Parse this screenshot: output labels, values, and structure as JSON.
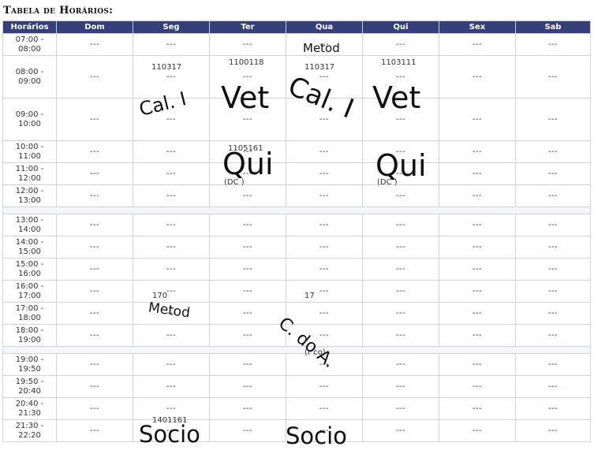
{
  "page_title": "Tabela de Horários:",
  "columns": [
    "Horários",
    "Dom",
    "Seg",
    "Ter",
    "Qua",
    "Qui",
    "Sex",
    "Sab"
  ],
  "empty_cell": "---",
  "rows": [
    {
      "start": "07:00 -",
      "end": "08:00"
    },
    {
      "start": "08:00 -",
      "end": "09:00"
    },
    {
      "start": "09:00 -",
      "end": "10:00"
    },
    {
      "start": "10:00 -",
      "end": "11:00"
    },
    {
      "start": "11:00 -",
      "end": "12:00"
    },
    {
      "start": "12:00 -",
      "end": "13:00"
    },
    {
      "start": "13:00 -",
      "end": "14:00"
    },
    {
      "start": "14:00 -",
      "end": "15:00"
    },
    {
      "start": "15:00 -",
      "end": "16:00"
    },
    {
      "start": "16:00 -",
      "end": "17:00"
    },
    {
      "start": "17:00 -",
      "end": "18:00"
    },
    {
      "start": "18:00 -",
      "end": "19:00"
    },
    {
      "start": "19:00 -",
      "end": "19:50"
    },
    {
      "start": "19:50 -",
      "end": "20:40"
    },
    {
      "start": "20:40 -",
      "end": "21:30"
    },
    {
      "start": "21:30 -",
      "end": "22:20"
    }
  ],
  "partial_codes": {
    "seg_morning": "110317",
    "ter_morning": "1100118",
    "qua_morning": "110317",
    "qui_morning": "1103111",
    "ter_late": "1105161",
    "seg_afternoon": "170",
    "qua_afternoon": "17",
    "seg_night": "1401161",
    "ter_paren_1": "(DC   )",
    "qui_paren_1": "(DC    )",
    "qua_paren_3": "(r    co)"
  },
  "handwritten_labels": {
    "metod_top": "Metod",
    "cal_seg": "Cal. I",
    "vet_ter": "Vet",
    "cal_qua": "Cal. I",
    "vet_qui": "Vet",
    "qui_ter": "Qui",
    "qui_qui": "Qui",
    "metod_seg": "Metod",
    "cdoa_qua": "C. do A.",
    "socio_seg": "Socio",
    "socio_qua": "Socio"
  }
}
